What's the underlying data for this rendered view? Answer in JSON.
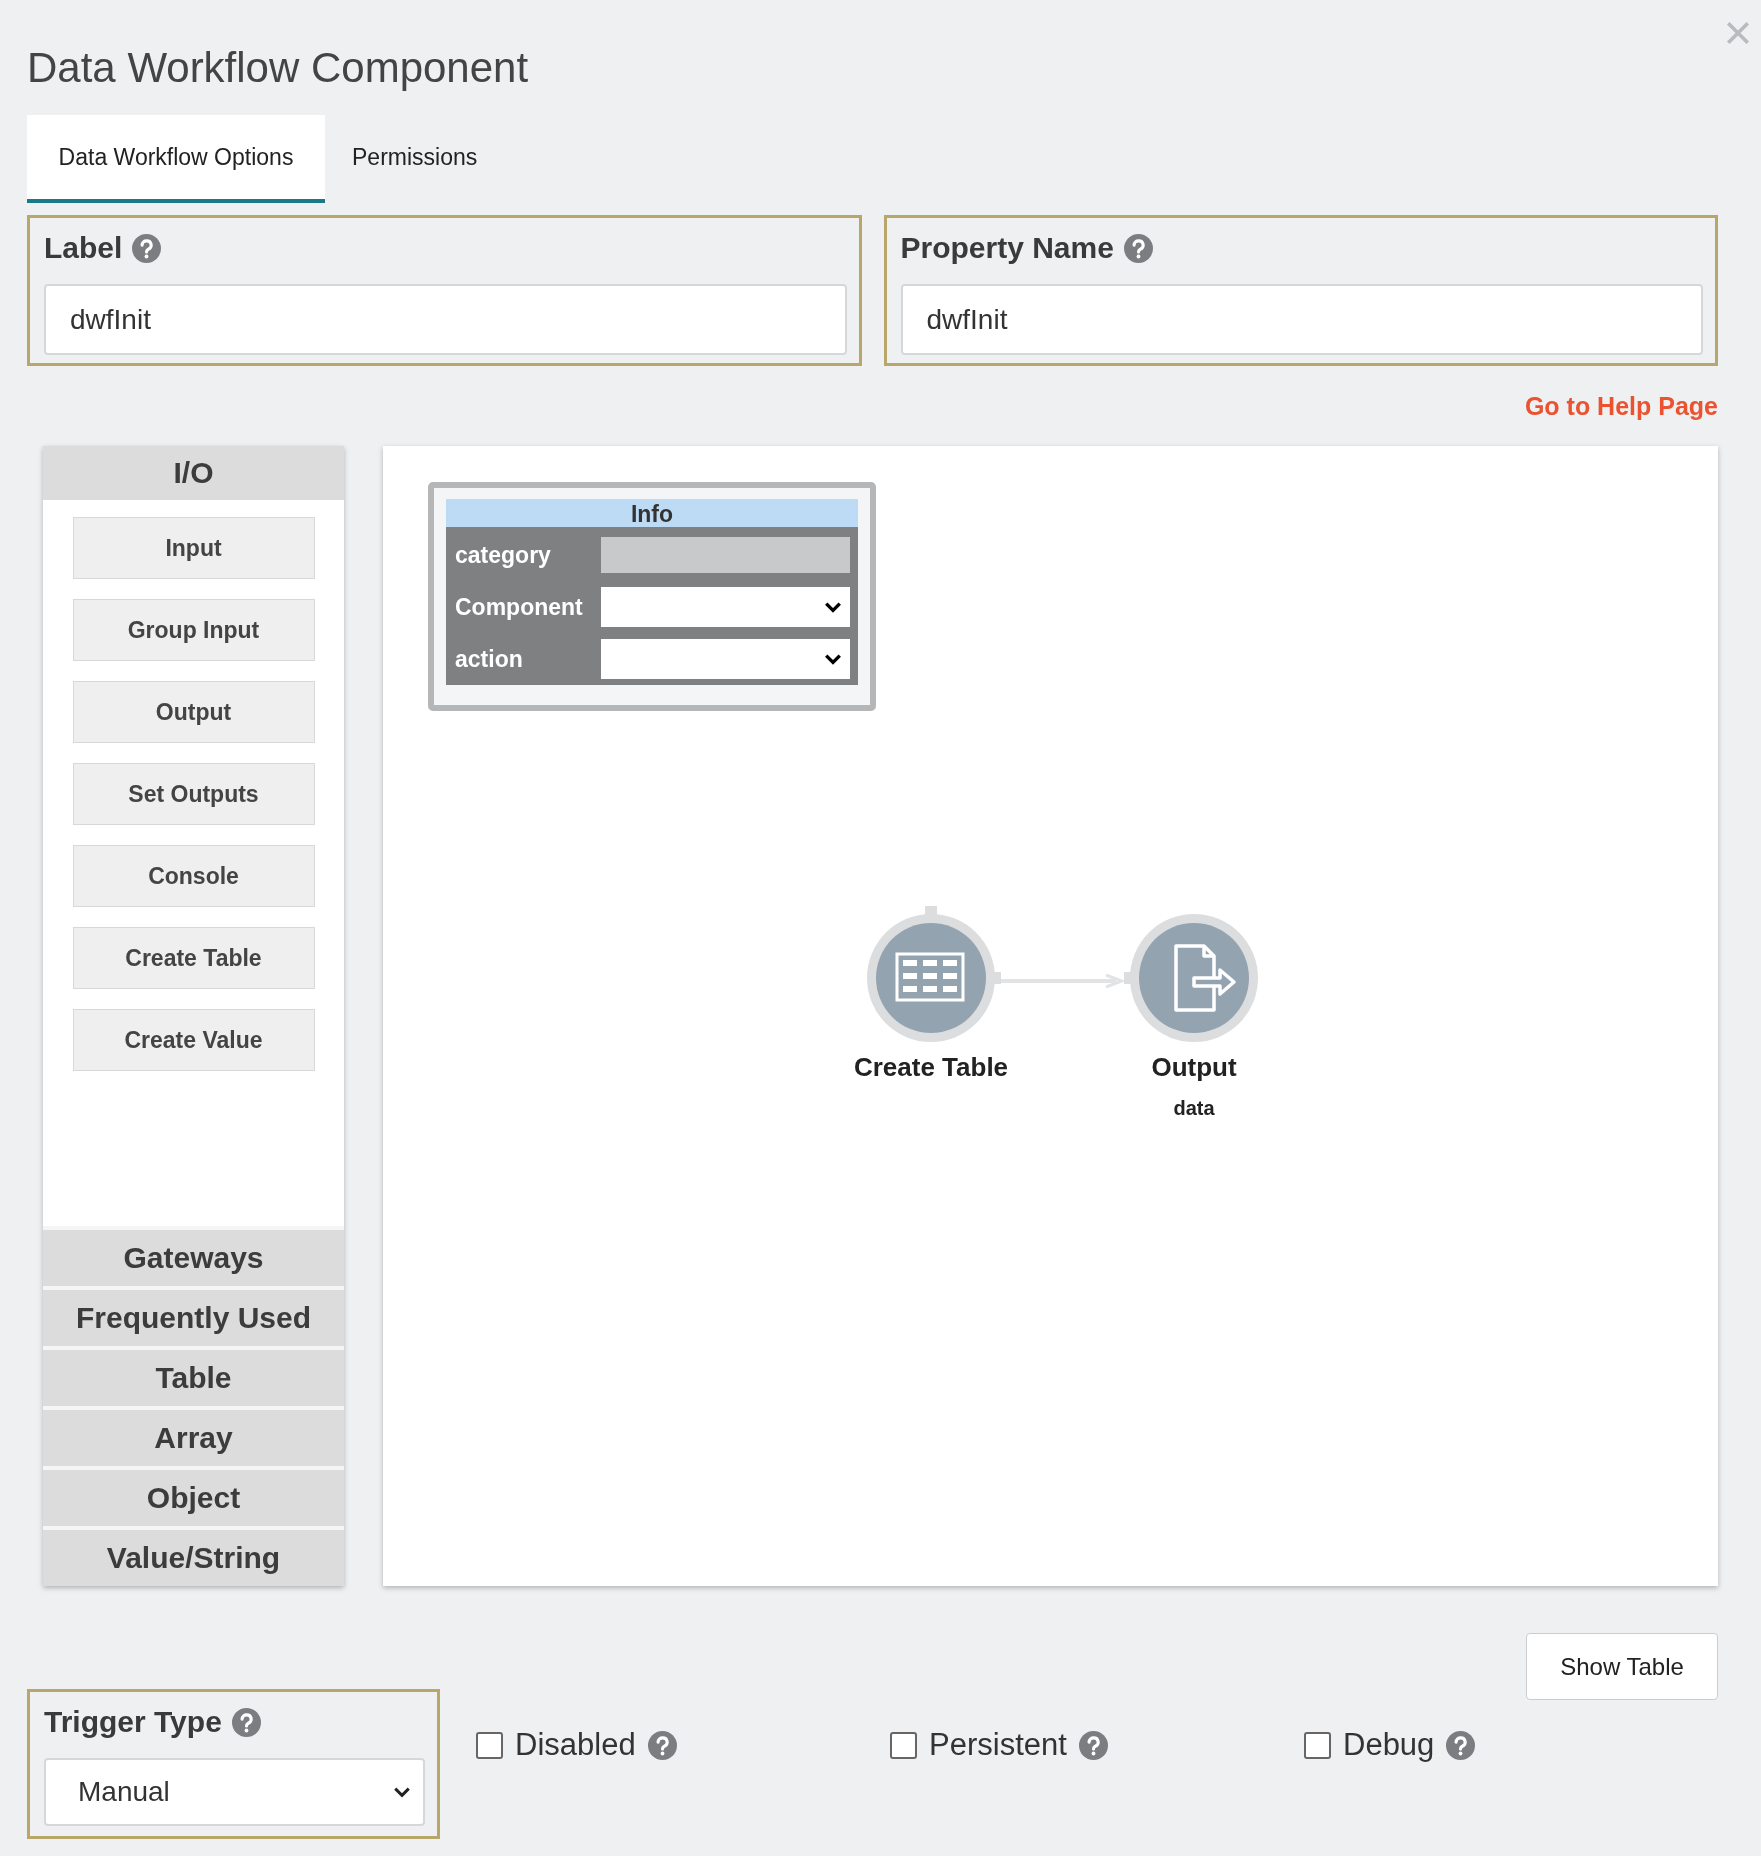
{
  "title": "Data Workflow Component",
  "tabs": [
    {
      "label": "Data Workflow Options",
      "selected": true
    },
    {
      "label": "Permissions",
      "selected": false
    }
  ],
  "fields": [
    {
      "label": "Label",
      "value": "dwfInit"
    },
    {
      "label": "Property Name",
      "value": "dwfInit"
    }
  ],
  "help_link": "Go to Help Page",
  "palette": [
    {
      "title": "I/O",
      "items": [
        "Input",
        "Group Input",
        "Output",
        "Set Outputs",
        "Console",
        "Create Table",
        "Create Value"
      ]
    },
    {
      "title": "Gateways"
    },
    {
      "title": "Frequently Used"
    },
    {
      "title": "Table"
    },
    {
      "title": "Array"
    },
    {
      "title": "Object"
    },
    {
      "title": "Value/String"
    }
  ],
  "info_panel": {
    "title": "Info",
    "rows": [
      {
        "label": "category",
        "kind": "readonly"
      },
      {
        "label": "Component",
        "kind": "select"
      },
      {
        "label": "action",
        "kind": "select"
      }
    ]
  },
  "nodes": [
    {
      "label": "Create Table",
      "kind": "table"
    },
    {
      "label": "Output",
      "sublabel": "data",
      "kind": "output"
    }
  ],
  "show_table_button": "Show Table",
  "trigger": {
    "label": "Trigger Type",
    "value": "Manual"
  },
  "options": [
    {
      "label": "Disabled",
      "checked": false
    },
    {
      "label": "Persistent",
      "checked": false
    },
    {
      "label": "Debug",
      "checked": false
    }
  ]
}
